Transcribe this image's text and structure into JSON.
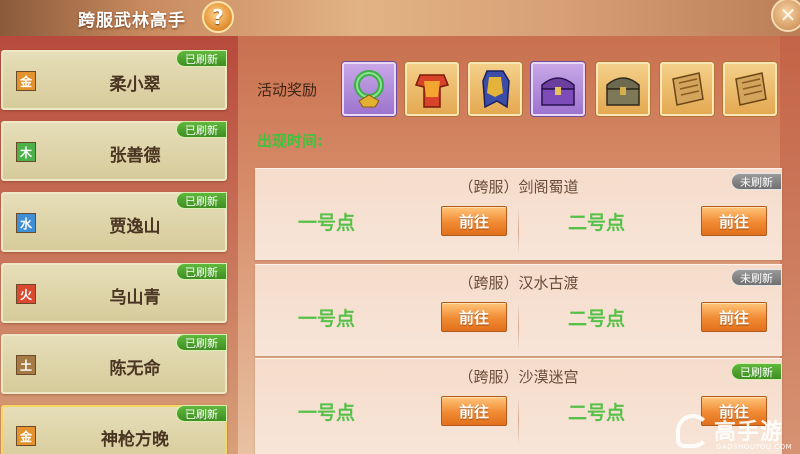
{
  "header": {
    "title": "跨服武林高手",
    "help_glyph": "?",
    "close_glyph": "✕"
  },
  "elements": [
    {
      "char": "金",
      "color": "#e4922e"
    },
    {
      "char": "木",
      "color": "#4bb14b"
    },
    {
      "char": "水",
      "color": "#3f8fd6"
    },
    {
      "char": "火",
      "color": "#d9482f"
    },
    {
      "char": "土",
      "color": "#a57a45"
    },
    {
      "char": "金",
      "color": "#e4922e"
    }
  ],
  "npc_list": [
    {
      "name": "柔小翠",
      "status": "已刷新"
    },
    {
      "name": "张善德",
      "status": "已刷新"
    },
    {
      "name": "贾逸山",
      "status": "已刷新"
    },
    {
      "name": "乌山青",
      "status": "已刷新"
    },
    {
      "name": "陈无命",
      "status": "已刷新"
    },
    {
      "name": "神枪方晚",
      "status": "已刷新"
    }
  ],
  "rewards": {
    "label": "活动奖励",
    "items": [
      "jade-pendant-icon",
      "red-armor-icon",
      "blue-armor-icon",
      "purple-chest-icon",
      "bronze-chest-icon",
      "scroll-icon",
      "scroll-icon"
    ]
  },
  "time_label": "出现时间:",
  "events": [
    {
      "location": "（跨服）剑阁蜀道",
      "status": "未刷新",
      "point1": "一号点",
      "point2": "二号点",
      "go_label": "前往"
    },
    {
      "location": "（跨服）汉水古渡",
      "status": "未刷新",
      "point1": "一号点",
      "point2": "二号点",
      "go_label": "前往"
    },
    {
      "location": "（跨服）沙漠迷宫",
      "status": "已刷新",
      "point1": "一号点",
      "point2": "二号点",
      "go_label": "前往"
    }
  ],
  "watermark": {
    "text": "高手游",
    "sub": "GAOSHOUYOU.COM"
  }
}
